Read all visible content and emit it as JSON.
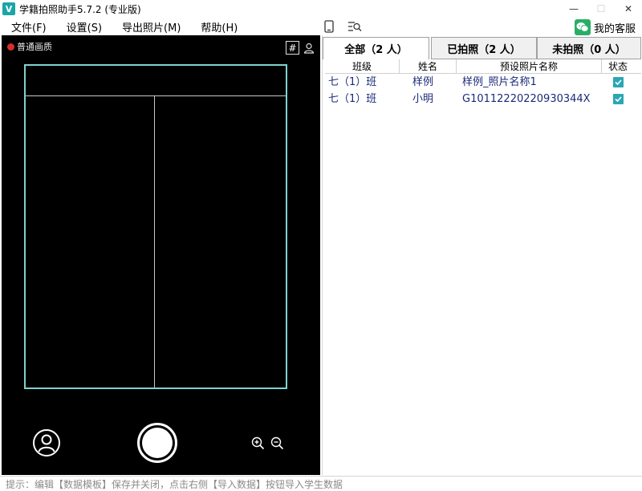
{
  "window": {
    "title": "学籍拍照助手5.7.2 (专业版)",
    "logo_letter": "V",
    "minimize": "—",
    "maximize": "☐",
    "close": "✕"
  },
  "menu": {
    "items": [
      {
        "label": "文件(F)"
      },
      {
        "label": "设置(S)"
      },
      {
        "label": "导出照片(M)"
      },
      {
        "label": "帮助(H)"
      }
    ],
    "service_label": "我的客服"
  },
  "camera": {
    "quality_label": "普通画质",
    "grid_glyph": "#"
  },
  "tabs": [
    {
      "label": "全部（2 人）",
      "active": true
    },
    {
      "label": "已拍照（2 人）",
      "active": false
    },
    {
      "label": "未拍照（0 人）",
      "active": false
    }
  ],
  "table": {
    "headers": [
      "班级",
      "姓名",
      "预设照片名称",
      "状态"
    ],
    "rows": [
      {
        "class": "七（1）班",
        "name": "样例",
        "photo_name": "样例_照片名称1",
        "done": true
      },
      {
        "class": "七（1）班",
        "name": "小明",
        "photo_name": "G10112220220930344X",
        "done": true
      }
    ]
  },
  "status": {
    "hint": "提示：编辑【数据模板】保存并关闭，点击右侧【导入数据】按钮导入学生数据"
  },
  "colors": {
    "frame": "#7fd3d0",
    "accent": "#2ba7b4",
    "record": "#d32f2f",
    "table_text": "#1b2a7a"
  }
}
